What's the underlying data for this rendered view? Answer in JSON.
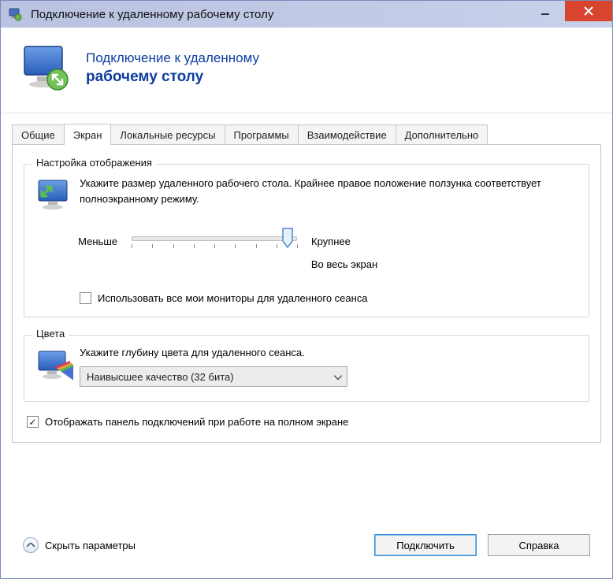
{
  "window": {
    "title": "Подключение к удаленному рабочему столу"
  },
  "banner": {
    "line1": "Подключение к удаленному",
    "line2": "рабочему столу"
  },
  "tabs": {
    "general": "Общие",
    "display": "Экран",
    "local": "Локальные ресурсы",
    "programs": "Программы",
    "experience": "Взаимодействие",
    "advanced": "Дополнительно"
  },
  "display_group": {
    "legend": "Настройка отображения",
    "desc": "Укажите размер удаленного рабочего стола. Крайнее правое положение ползунка соответствует полноэкранному режиму.",
    "slider_min": "Меньше",
    "slider_max": "Крупнее",
    "slider_value": "Во весь экран",
    "multi_monitor": "Использовать все мои мониторы для удаленного сеанса",
    "multi_monitor_checked": false
  },
  "colors_group": {
    "legend": "Цвета",
    "desc": "Укажите глубину цвета для удаленного сеанса.",
    "dropdown_value": "Наивысшее качество (32 бита)"
  },
  "connection_bar": {
    "label": "Отображать панель подключений при работе на полном экране",
    "checked": true
  },
  "footer": {
    "hide_options": "Скрыть параметры",
    "connect": "Подключить",
    "help": "Справка"
  }
}
